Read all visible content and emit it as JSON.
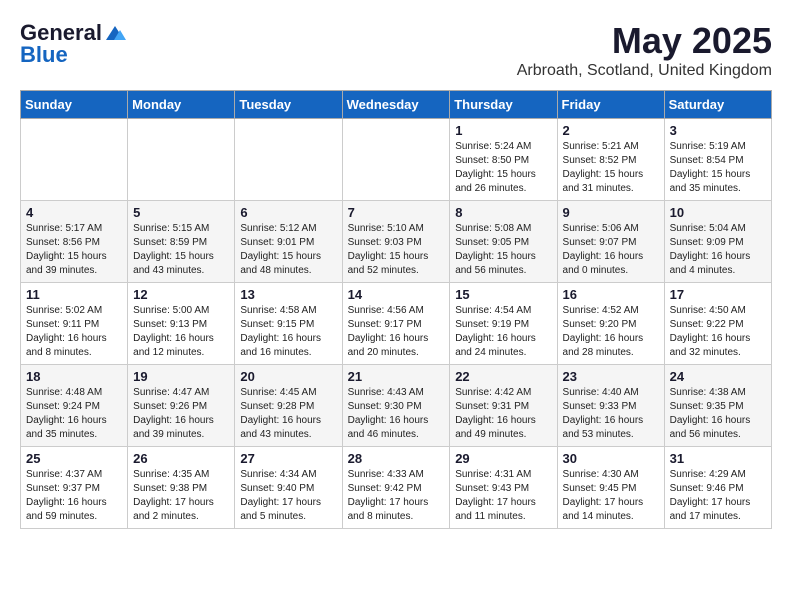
{
  "header": {
    "logo_general": "General",
    "logo_blue": "Blue",
    "month_title": "May 2025",
    "location": "Arbroath, Scotland, United Kingdom"
  },
  "days_of_week": [
    "Sunday",
    "Monday",
    "Tuesday",
    "Wednesday",
    "Thursday",
    "Friday",
    "Saturday"
  ],
  "weeks": [
    [
      {
        "day": "",
        "info": ""
      },
      {
        "day": "",
        "info": ""
      },
      {
        "day": "",
        "info": ""
      },
      {
        "day": "",
        "info": ""
      },
      {
        "day": "1",
        "info": "Sunrise: 5:24 AM\nSunset: 8:50 PM\nDaylight: 15 hours\nand 26 minutes."
      },
      {
        "day": "2",
        "info": "Sunrise: 5:21 AM\nSunset: 8:52 PM\nDaylight: 15 hours\nand 31 minutes."
      },
      {
        "day": "3",
        "info": "Sunrise: 5:19 AM\nSunset: 8:54 PM\nDaylight: 15 hours\nand 35 minutes."
      }
    ],
    [
      {
        "day": "4",
        "info": "Sunrise: 5:17 AM\nSunset: 8:56 PM\nDaylight: 15 hours\nand 39 minutes."
      },
      {
        "day": "5",
        "info": "Sunrise: 5:15 AM\nSunset: 8:59 PM\nDaylight: 15 hours\nand 43 minutes."
      },
      {
        "day": "6",
        "info": "Sunrise: 5:12 AM\nSunset: 9:01 PM\nDaylight: 15 hours\nand 48 minutes."
      },
      {
        "day": "7",
        "info": "Sunrise: 5:10 AM\nSunset: 9:03 PM\nDaylight: 15 hours\nand 52 minutes."
      },
      {
        "day": "8",
        "info": "Sunrise: 5:08 AM\nSunset: 9:05 PM\nDaylight: 15 hours\nand 56 minutes."
      },
      {
        "day": "9",
        "info": "Sunrise: 5:06 AM\nSunset: 9:07 PM\nDaylight: 16 hours\nand 0 minutes."
      },
      {
        "day": "10",
        "info": "Sunrise: 5:04 AM\nSunset: 9:09 PM\nDaylight: 16 hours\nand 4 minutes."
      }
    ],
    [
      {
        "day": "11",
        "info": "Sunrise: 5:02 AM\nSunset: 9:11 PM\nDaylight: 16 hours\nand 8 minutes."
      },
      {
        "day": "12",
        "info": "Sunrise: 5:00 AM\nSunset: 9:13 PM\nDaylight: 16 hours\nand 12 minutes."
      },
      {
        "day": "13",
        "info": "Sunrise: 4:58 AM\nSunset: 9:15 PM\nDaylight: 16 hours\nand 16 minutes."
      },
      {
        "day": "14",
        "info": "Sunrise: 4:56 AM\nSunset: 9:17 PM\nDaylight: 16 hours\nand 20 minutes."
      },
      {
        "day": "15",
        "info": "Sunrise: 4:54 AM\nSunset: 9:19 PM\nDaylight: 16 hours\nand 24 minutes."
      },
      {
        "day": "16",
        "info": "Sunrise: 4:52 AM\nSunset: 9:20 PM\nDaylight: 16 hours\nand 28 minutes."
      },
      {
        "day": "17",
        "info": "Sunrise: 4:50 AM\nSunset: 9:22 PM\nDaylight: 16 hours\nand 32 minutes."
      }
    ],
    [
      {
        "day": "18",
        "info": "Sunrise: 4:48 AM\nSunset: 9:24 PM\nDaylight: 16 hours\nand 35 minutes."
      },
      {
        "day": "19",
        "info": "Sunrise: 4:47 AM\nSunset: 9:26 PM\nDaylight: 16 hours\nand 39 minutes."
      },
      {
        "day": "20",
        "info": "Sunrise: 4:45 AM\nSunset: 9:28 PM\nDaylight: 16 hours\nand 43 minutes."
      },
      {
        "day": "21",
        "info": "Sunrise: 4:43 AM\nSunset: 9:30 PM\nDaylight: 16 hours\nand 46 minutes."
      },
      {
        "day": "22",
        "info": "Sunrise: 4:42 AM\nSunset: 9:31 PM\nDaylight: 16 hours\nand 49 minutes."
      },
      {
        "day": "23",
        "info": "Sunrise: 4:40 AM\nSunset: 9:33 PM\nDaylight: 16 hours\nand 53 minutes."
      },
      {
        "day": "24",
        "info": "Sunrise: 4:38 AM\nSunset: 9:35 PM\nDaylight: 16 hours\nand 56 minutes."
      }
    ],
    [
      {
        "day": "25",
        "info": "Sunrise: 4:37 AM\nSunset: 9:37 PM\nDaylight: 16 hours\nand 59 minutes."
      },
      {
        "day": "26",
        "info": "Sunrise: 4:35 AM\nSunset: 9:38 PM\nDaylight: 17 hours\nand 2 minutes."
      },
      {
        "day": "27",
        "info": "Sunrise: 4:34 AM\nSunset: 9:40 PM\nDaylight: 17 hours\nand 5 minutes."
      },
      {
        "day": "28",
        "info": "Sunrise: 4:33 AM\nSunset: 9:42 PM\nDaylight: 17 hours\nand 8 minutes."
      },
      {
        "day": "29",
        "info": "Sunrise: 4:31 AM\nSunset: 9:43 PM\nDaylight: 17 hours\nand 11 minutes."
      },
      {
        "day": "30",
        "info": "Sunrise: 4:30 AM\nSunset: 9:45 PM\nDaylight: 17 hours\nand 14 minutes."
      },
      {
        "day": "31",
        "info": "Sunrise: 4:29 AM\nSunset: 9:46 PM\nDaylight: 17 hours\nand 17 minutes."
      }
    ]
  ]
}
